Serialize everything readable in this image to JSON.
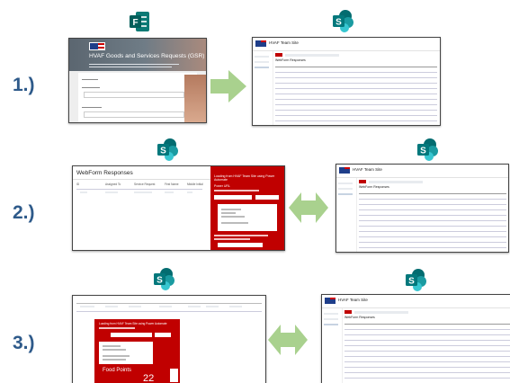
{
  "steps": [
    "1.)",
    "2.)",
    "3.)"
  ],
  "icons": {
    "forms": "microsoft-forms-icon",
    "sharepoint": "sharepoint-icon",
    "arrow_right": "green-arrow-right",
    "arrow_both": "green-arrow-double"
  },
  "colors": {
    "green_arrow": "#a9d18e",
    "forms_teal": "#0b7a75",
    "sharepoint_teal": "#03787c",
    "panel_red": "#c00000",
    "step_blue": "#2e5a8a"
  },
  "form": {
    "title": "HVAF Goods and Services Requests (GSR)"
  },
  "sharepoint_site": {
    "title": "HVAF Team Site",
    "list_title": "WebForm Responses"
  },
  "webform_responses": {
    "title": "WebForm Responses",
    "columns": [
      "ID",
      "Assigned To",
      "Service Request",
      "First Name",
      "Middle Initial"
    ]
  },
  "panel": {
    "heading": "Loading from HVAF Team Site using Power Automate",
    "power_url_label": "Power URL",
    "food_points_label": "Food Points",
    "food_points_value": "22"
  }
}
